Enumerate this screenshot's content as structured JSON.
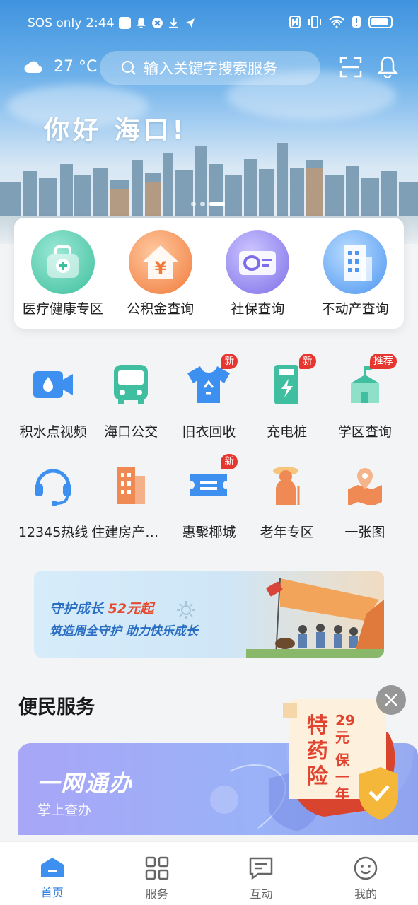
{
  "status_bar": {
    "carrier": "SOS only",
    "time": "2:44"
  },
  "header": {
    "weather_temp": "27 °C",
    "search_placeholder": "输入关键字搜索服务"
  },
  "hero": {
    "greeting": "你好 海口!"
  },
  "quick_services": [
    {
      "label": "医疗健康专区",
      "icon": "medical-kit-icon"
    },
    {
      "label": "公积金查询",
      "icon": "housing-fund-icon"
    },
    {
      "label": "社保查询",
      "icon": "social-security-card-icon"
    },
    {
      "label": "不动产查询",
      "icon": "real-estate-building-icon"
    }
  ],
  "grid_services": [
    {
      "label": "积水点视频",
      "icon": "video-camera-icon"
    },
    {
      "label": "海口公交",
      "icon": "bus-icon"
    },
    {
      "label": "旧衣回收",
      "icon": "clothes-recycle-icon",
      "badge": "新"
    },
    {
      "label": "充电桩",
      "icon": "charging-pile-icon",
      "badge": "新"
    },
    {
      "label": "学区查询",
      "icon": "school-icon",
      "badge": "推荐"
    },
    {
      "label": "12345热线",
      "icon": "headset-icon"
    },
    {
      "label": "住建房产信...",
      "icon": "apartment-building-icon"
    },
    {
      "label": "惠聚椰城",
      "icon": "ticket-icon",
      "badge": "新"
    },
    {
      "label": "老年专区",
      "icon": "elderly-icon"
    },
    {
      "label": "一张图",
      "icon": "map-pin-icon"
    }
  ],
  "banner": {
    "line1_prefix": "守护成长",
    "line1_highlight": "52元起",
    "line2": "筑造周全守护 助力快乐成长"
  },
  "section": {
    "title": "便民服务",
    "card_title": "一网通办",
    "card_subtitle": "掌上查办"
  },
  "promo": {
    "main": "特药险",
    "price": "29元",
    "period": "保一年"
  },
  "tabs": [
    {
      "label": "首页",
      "icon": "home-icon",
      "active": true
    },
    {
      "label": "服务",
      "icon": "grid-icon",
      "active": false
    },
    {
      "label": "互动",
      "icon": "chat-icon",
      "active": false
    },
    {
      "label": "我的",
      "icon": "profile-face-icon",
      "active": false
    }
  ],
  "colors": {
    "primary": "#2f7fe0",
    "badge": "#e5362f",
    "teal": "#3fbf9f"
  }
}
